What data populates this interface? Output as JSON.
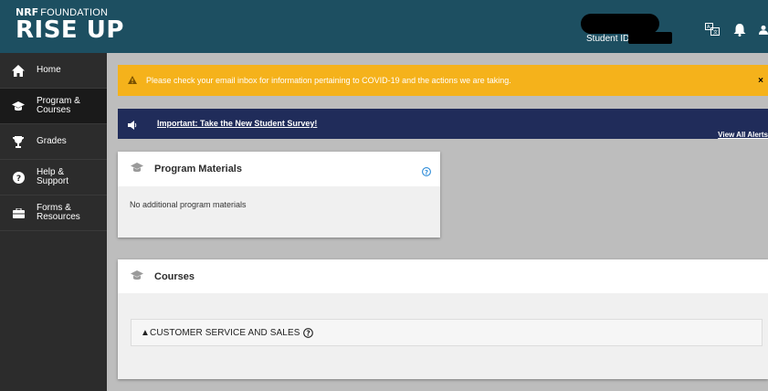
{
  "header": {
    "logo_prefix": "NRF",
    "logo_suffix": "FOUNDATION",
    "logo_main": "RISE UP",
    "student_id_label": "Student ID: 55",
    "bg_color": "#1d4f61"
  },
  "sidebar": {
    "items": [
      {
        "label": "Home",
        "icon": "home-icon"
      },
      {
        "label": "Program &\nCourses",
        "icon": "graduation-cap-icon"
      },
      {
        "label": "Grades",
        "icon": "trophy-icon"
      },
      {
        "label": "Help &\nSupport",
        "icon": "question-icon"
      },
      {
        "label": "Forms &\nResources",
        "icon": "briefcase-icon"
      }
    ],
    "active_index": 1
  },
  "alerts": {
    "covid_message": "Please check your email inbox for information pertaining to COVID-19 and the actions we are taking.",
    "close_label": "×",
    "survey_link": "Important: Take the New Student Survey!",
    "view_all": "View All Alerts"
  },
  "program_materials": {
    "title": "Program Materials",
    "empty_text": "No additional program materials"
  },
  "courses": {
    "title": "Courses",
    "items": [
      {
        "name": "▲CUSTOMER SERVICE AND SALES"
      }
    ]
  }
}
